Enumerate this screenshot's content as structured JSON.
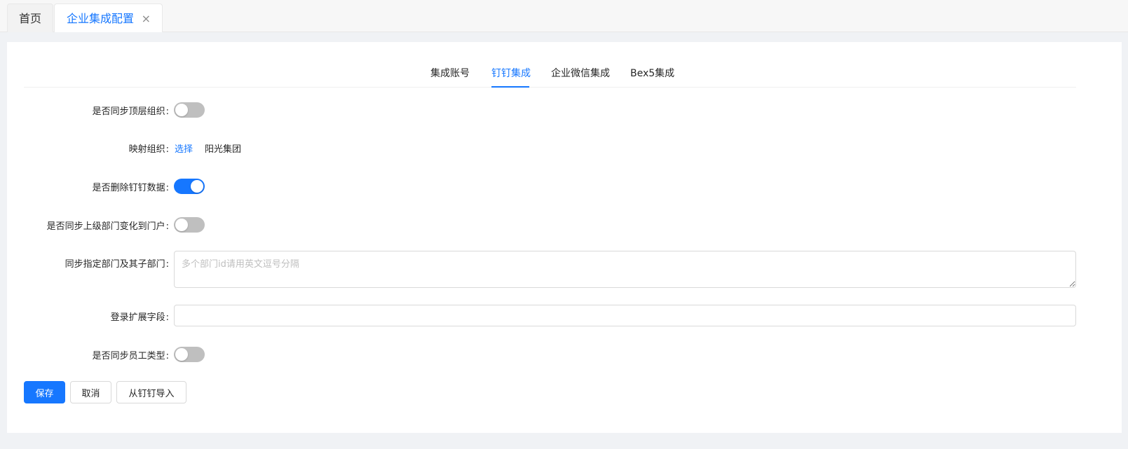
{
  "tabs": {
    "home_label": "首页",
    "current_label": "企业集成配置",
    "close_glyph": "×"
  },
  "subtabs": [
    {
      "label": "集成账号",
      "active": false
    },
    {
      "label": "钉钉集成",
      "active": true
    },
    {
      "label": "企业微信集成",
      "active": false
    },
    {
      "label": "Bex5集成",
      "active": false
    }
  ],
  "form": {
    "sync_top_org": {
      "label": "是否同步顶层组织",
      "enabled": false
    },
    "mapping_org": {
      "label": "映射组织",
      "select_link": "选择",
      "value": "阳光集团"
    },
    "delete_dingtalk_data": {
      "label": "是否删除钉钉数据",
      "enabled": true
    },
    "sync_parent_dept_change": {
      "label": "是否同步上级部门变化到门户",
      "enabled": false
    },
    "sync_specified_depts": {
      "label": "同步指定部门及其子部门",
      "placeholder": "多个部门id请用英文逗号分隔",
      "value": ""
    },
    "login_ext_field": {
      "label": "登录扩展字段",
      "value": ""
    },
    "sync_employee_type": {
      "label": "是否同步员工类型",
      "enabled": false
    }
  },
  "buttons": {
    "save": "保存",
    "cancel": "取消",
    "import_from_dingtalk": "从钉钉导入"
  },
  "colors": {
    "accent": "#1677ff",
    "switch_off": "#bfbfbf"
  }
}
